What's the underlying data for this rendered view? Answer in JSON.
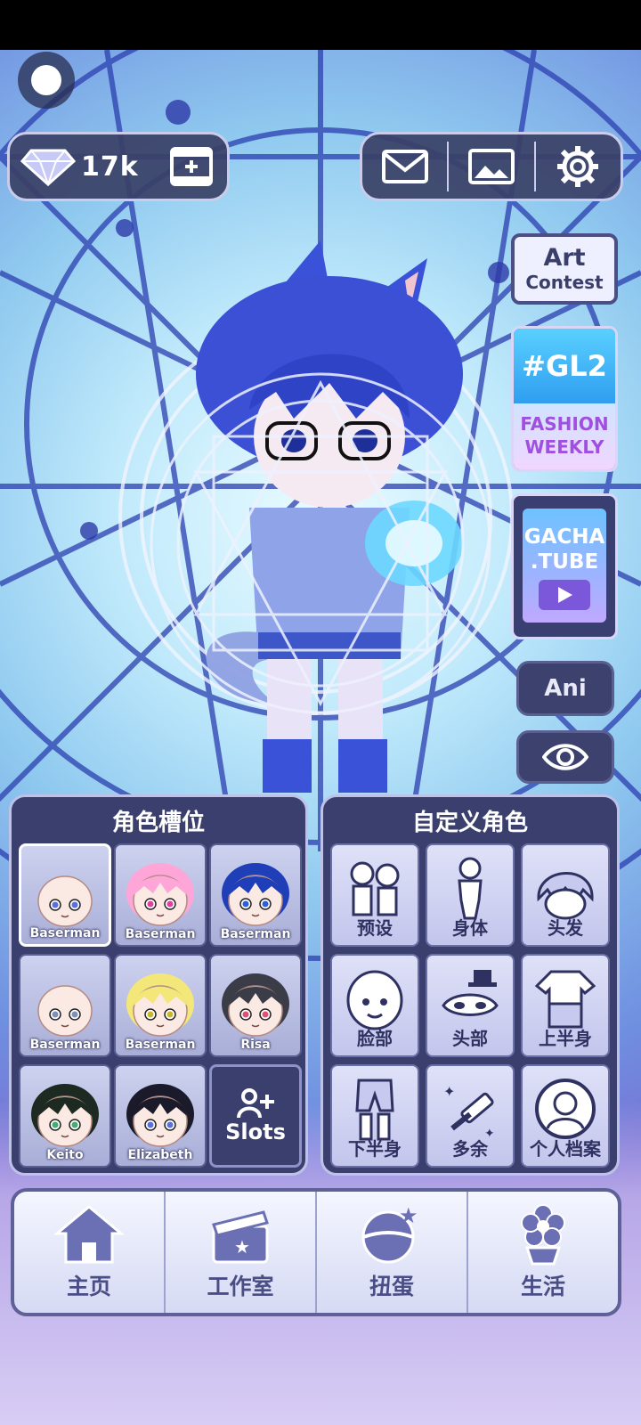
{
  "currency": {
    "gems": "17k",
    "gem_icon": "diamond-icon",
    "video_icon": "film-plus-icon"
  },
  "top_buttons": [
    {
      "icon": "mail-icon"
    },
    {
      "icon": "gallery-icon"
    },
    {
      "icon": "gear-icon"
    }
  ],
  "side": {
    "art_contest": {
      "line1": "Art",
      "line2": "Contest"
    },
    "gl2": {
      "tag": "#GL2",
      "line1": "FASHION",
      "line2": "WEEKLY"
    },
    "gacha_tube": {
      "line1": "GACHA",
      "line2": ".TUBE"
    },
    "ani_label": "Ani",
    "eye_icon": "eye-icon"
  },
  "slots_panel": {
    "title": "角色槽位",
    "slots": [
      {
        "name": "Baserman",
        "hair": "none",
        "eye": "#5a6fe0",
        "selected": true
      },
      {
        "name": "Baserman",
        "hair": "#ffa6d8",
        "eye": "#e040a0"
      },
      {
        "name": "Baserman",
        "hair": "#1f3fb8",
        "eye": "#2f5fd8"
      },
      {
        "name": "Baserman",
        "hair": "none",
        "eye": "#7f8fb8"
      },
      {
        "name": "Baserman",
        "hair": "#f3e77a",
        "eye": "#c9b82a"
      },
      {
        "name": "Risa",
        "hair": "#3a3c48",
        "eye": "#e05070"
      },
      {
        "name": "Keito",
        "hair": "#1c2a22",
        "eye": "#3fae6f"
      },
      {
        "name": "Elizabeth",
        "hair": "#1b1a2a",
        "eye": "#5a6fe0"
      }
    ],
    "add_label": "Slots"
  },
  "custom_panel": {
    "title": "自定义角色",
    "items": [
      {
        "label": "预设",
        "icon": "preset-icon"
      },
      {
        "label": "身体",
        "icon": "body-icon"
      },
      {
        "label": "头发",
        "icon": "hair-icon"
      },
      {
        "label": "脸部",
        "icon": "face-icon"
      },
      {
        "label": "头部",
        "icon": "head-accessory-icon"
      },
      {
        "label": "上半身",
        "icon": "shirt-icon"
      },
      {
        "label": "下半身",
        "icon": "pants-icon"
      },
      {
        "label": "多余",
        "icon": "extra-icon"
      },
      {
        "label": "个人档案",
        "icon": "profile-icon"
      }
    ]
  },
  "bottom_nav": [
    {
      "label": "主页",
      "icon": "home-icon"
    },
    {
      "label": "工作室",
      "icon": "clapperboard-icon"
    },
    {
      "label": "扭蛋",
      "icon": "gacha-ball-icon"
    },
    {
      "label": "生活",
      "icon": "flower-icon"
    }
  ]
}
